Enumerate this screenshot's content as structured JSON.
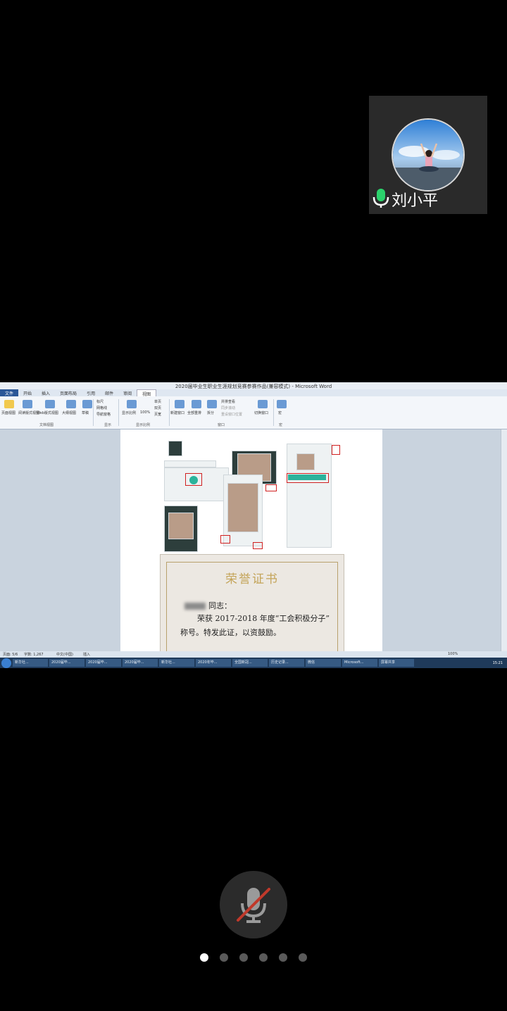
{
  "participant": {
    "name": "刘小平",
    "mic_icon": "microphone-icon",
    "avatar": "avatar-photo"
  },
  "shared_screen": {
    "window_title": "2020届毕业生职业生涯规划竞赛参赛作品(兼容模式) - Microsoft Word",
    "tabs": [
      "文件",
      "开始",
      "插入",
      "页面布局",
      "引用",
      "邮件",
      "审阅",
      "视图"
    ],
    "active_tab": "视图",
    "ribbon_groups": [
      "文档视图",
      "显示",
      "显示比例",
      "窗口",
      "宏"
    ],
    "ribbon_buttons": [
      "页面视图",
      "阅读版式视图",
      "Web版式视图",
      "大纲视图",
      "草稿",
      "标尺",
      "网格线",
      "导航窗格",
      "显示比例",
      "100%",
      "单页",
      "双页",
      "页宽",
      "新建窗口",
      "全部重排",
      "拆分",
      "并排查看",
      "同步滚动",
      "重设窗口位置",
      "切换窗口",
      "宏"
    ],
    "certificate": {
      "title": "荣誉证书",
      "greeting": "同志：",
      "line1": "荣获 2017-2018 年度“工会积极分子”",
      "line2": "称号。特发此证，以资鼓励。"
    },
    "status_bar": {
      "page": "页面: 5/6",
      "words": "字数: 1,267",
      "lang": "中文(中国)",
      "mode": "插入",
      "zoom": "100%"
    },
    "taskbar_items": [
      "新华社...",
      "2020届毕...",
      "2020届毕...",
      "2020届毕...",
      "新华社...",
      "2020年毕...",
      "全国新冠...",
      "历史记录...",
      "微信",
      "Microsoft...",
      "屏幕共享"
    ],
    "clock": "15:21"
  },
  "controls": {
    "mute_icon": "microphone-muted-icon",
    "pages": 6,
    "current_page": 1
  }
}
